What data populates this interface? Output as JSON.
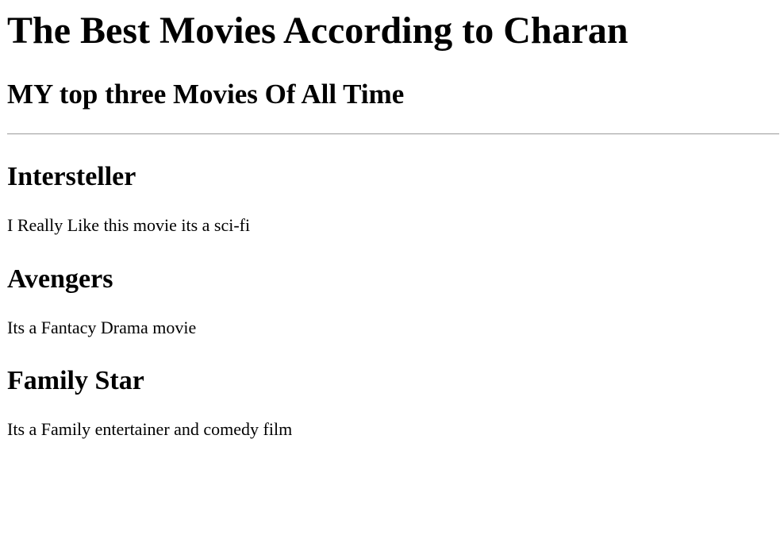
{
  "page": {
    "title": "The Best Movies According to Charan",
    "subtitle": "MY top three Movies Of All Time"
  },
  "movies": [
    {
      "title": "Intersteller",
      "description": "I Really Like this movie its a sci-fi"
    },
    {
      "title": "Avengers",
      "description": "Its a Fantacy Drama movie"
    },
    {
      "title": "Family Star",
      "description": "Its a Family entertainer and comedy film"
    }
  ]
}
